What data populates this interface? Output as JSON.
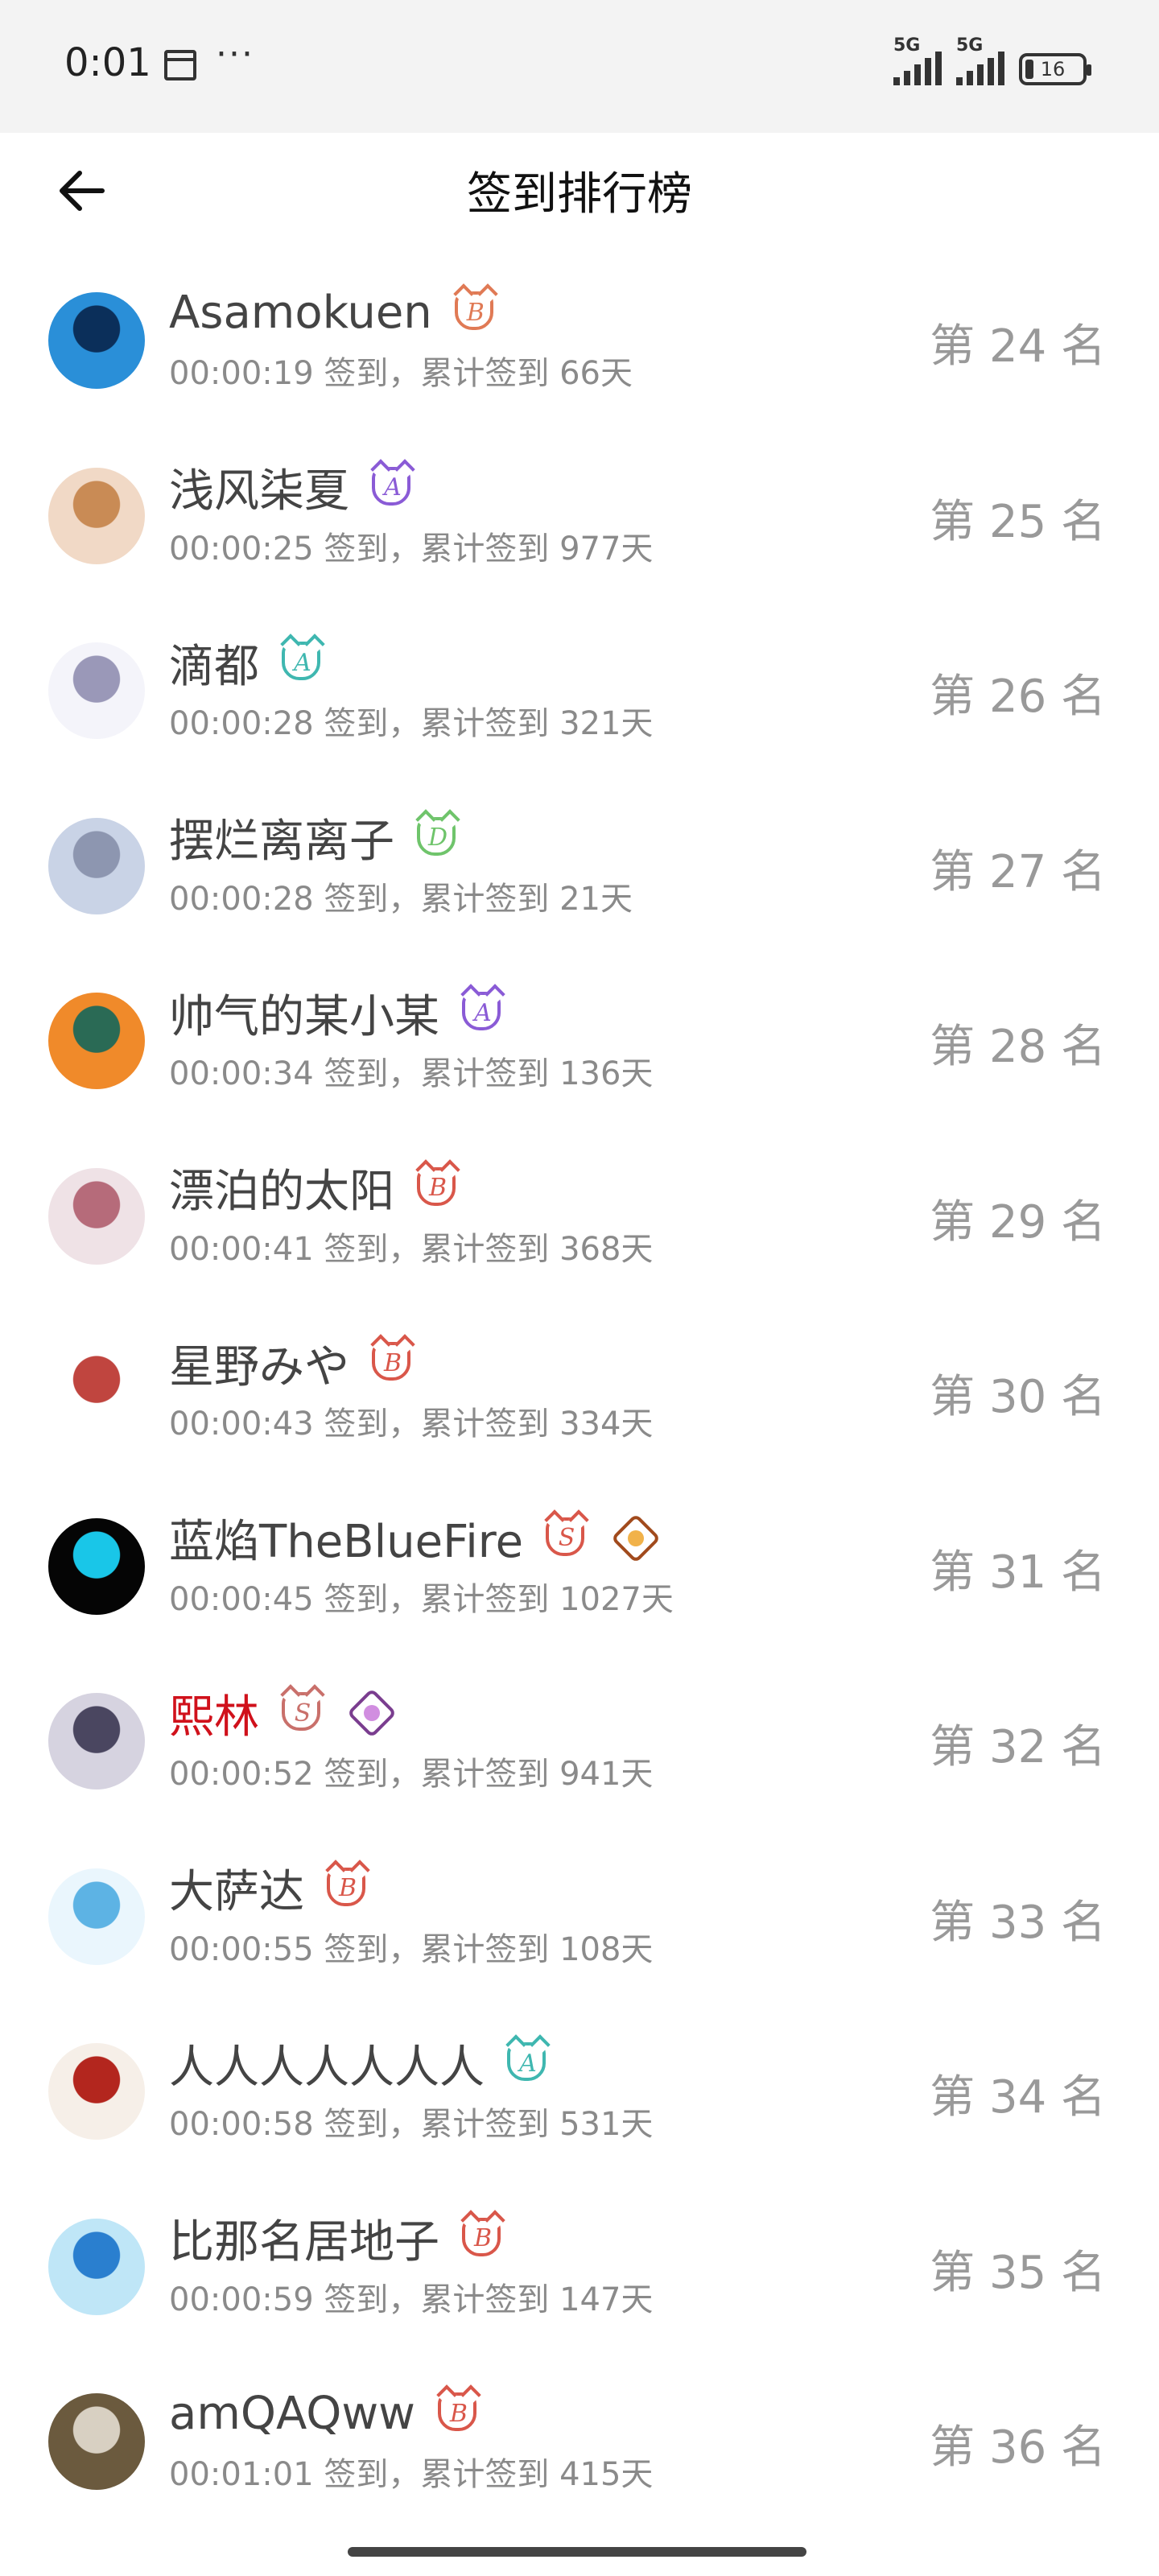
{
  "status_bar": {
    "time": "0:01",
    "notification_count": "1",
    "more": "···",
    "signal1_label": "5G",
    "signal2_label": "5G",
    "battery": "16"
  },
  "header": {
    "title": "签到排行榜",
    "back_icon": "arrow-left-icon"
  },
  "entries": [
    {
      "name": "Asamokuen",
      "name_color": "#444444",
      "meta": "00:00:19 签到，累计签到 66天",
      "rank": "第 24 名",
      "badges": [
        {
          "type": "level",
          "letter": "B",
          "color": "#e07a55"
        }
      ],
      "avatar": {
        "bg": "#2a8fd8",
        "fg": "#0b2f5a"
      }
    },
    {
      "name": "浅风柒夏",
      "name_color": "#444444",
      "meta": "00:00:25 签到，累计签到 977天",
      "rank": "第 25 名",
      "badges": [
        {
          "type": "level",
          "letter": "A",
          "color": "#8a5bd6"
        }
      ],
      "avatar": {
        "bg": "#f1d9c6",
        "fg": "#c98b55"
      }
    },
    {
      "name": "滴都",
      "name_color": "#444444",
      "meta": "00:00:28 签到，累计签到 321天",
      "rank": "第 26 名",
      "badges": [
        {
          "type": "level",
          "letter": "A",
          "color": "#3fb7b0"
        }
      ],
      "avatar": {
        "bg": "#f4f4fa",
        "fg": "#9a98b8"
      }
    },
    {
      "name": "摆烂离离子",
      "name_color": "#444444",
      "meta": "00:00:28 签到，累计签到 21天",
      "rank": "第 27 名",
      "badges": [
        {
          "type": "level",
          "letter": "D",
          "color": "#6fc46b"
        }
      ],
      "avatar": {
        "bg": "#c9d3e6",
        "fg": "#8d96b0"
      }
    },
    {
      "name": "帅气的某小某",
      "name_color": "#444444",
      "meta": "00:00:34 签到，累计签到 136天",
      "rank": "第 28 名",
      "badges": [
        {
          "type": "level",
          "letter": "A",
          "color": "#8a5bd6"
        }
      ],
      "avatar": {
        "bg": "#f08a2a",
        "fg": "#2a6a55"
      }
    },
    {
      "name": "漂泊的太阳",
      "name_color": "#444444",
      "meta": "00:00:41 签到，累计签到 368天",
      "rank": "第 29 名",
      "badges": [
        {
          "type": "level",
          "letter": "B",
          "color": "#d9574a"
        }
      ],
      "avatar": {
        "bg": "#efe2e6",
        "fg": "#b66b7a"
      }
    },
    {
      "name": "星野みや",
      "name_color": "#444444",
      "meta": "00:00:43 签到，累计签到 334天",
      "rank": "第 30 名",
      "badges": [
        {
          "type": "level",
          "letter": "B",
          "color": "#d9574a"
        }
      ],
      "avatar": {
        "bg": "#ffffff",
        "fg": "#c0453f"
      }
    },
    {
      "name": "蓝焰TheBlueFire",
      "name_color": "#444444",
      "meta": "00:00:45 签到，累计签到 1027天",
      "rank": "第 31 名",
      "badges": [
        {
          "type": "level",
          "letter": "S",
          "color": "#d9574a"
        },
        {
          "type": "gem",
          "letter": "",
          "color": "#a14a1c",
          "inner": "#f1b24a"
        }
      ],
      "avatar": {
        "bg": "#050505",
        "fg": "#19c6e8"
      }
    },
    {
      "name": "熙林",
      "name_color": "#d0111b",
      "meta": "00:00:52 签到，累计签到 941天",
      "rank": "第 32 名",
      "badges": [
        {
          "type": "level",
          "letter": "S",
          "color": "#c9706b"
        },
        {
          "type": "gem",
          "letter": "",
          "color": "#7a3d8f",
          "inner": "#d18ee0"
        }
      ],
      "avatar": {
        "bg": "#d6d3e0",
        "fg": "#4a4660"
      }
    },
    {
      "name": "大萨达",
      "name_color": "#444444",
      "meta": "00:00:55 签到，累计签到 108天",
      "rank": "第 33 名",
      "badges": [
        {
          "type": "level",
          "letter": "B",
          "color": "#d9574a"
        }
      ],
      "avatar": {
        "bg": "#eaf6fd",
        "fg": "#5db3e4"
      }
    },
    {
      "name": "人人人人人人人",
      "name_color": "#444444",
      "meta": "00:00:58 签到，累计签到 531天",
      "rank": "第 34 名",
      "badges": [
        {
          "type": "level",
          "letter": "A",
          "color": "#3fb7b0"
        }
      ],
      "avatar": {
        "bg": "#f6efe8",
        "fg": "#b3261e"
      }
    },
    {
      "name": "比那名居地子",
      "name_color": "#444444",
      "meta": "00:00:59 签到，累计签到 147天",
      "rank": "第 35 名",
      "badges": [
        {
          "type": "level",
          "letter": "B",
          "color": "#d9574a"
        }
      ],
      "avatar": {
        "bg": "#bfe6f7",
        "fg": "#2a7fcf"
      }
    },
    {
      "name": "amQAQww",
      "name_color": "#444444",
      "meta": "00:01:01 签到，累计签到 415天",
      "rank": "第 36 名",
      "badges": [
        {
          "type": "level",
          "letter": "B",
          "color": "#d9574a"
        }
      ],
      "avatar": {
        "bg": "#6b5a3e",
        "fg": "#d8d0c2"
      }
    }
  ]
}
